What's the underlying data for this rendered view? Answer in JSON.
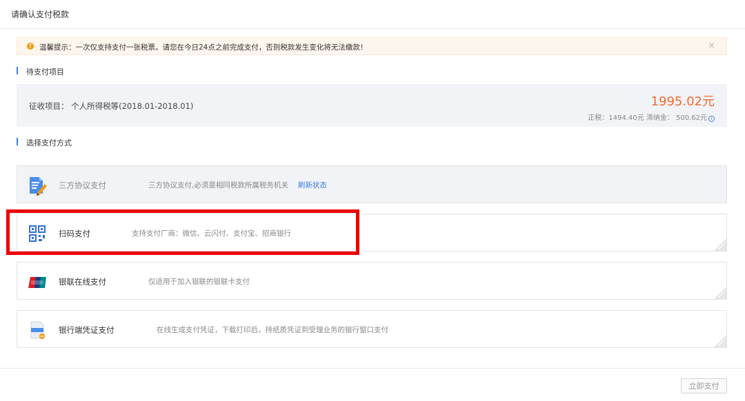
{
  "header": {
    "title": "请确认支付税款"
  },
  "alert": {
    "text": "温馨提示：一次仅支持支付一张税票。请您在今日24点之前完成支付，否则税款发生变化将无法缴款！",
    "close": "×"
  },
  "sections": {
    "pending": "待支付项目",
    "method": "选择支付方式"
  },
  "tax": {
    "label": "征收项目：  个人所得税等(2018.01-2018.01)",
    "amount": "1995.02元",
    "detail": "正税：1494.40元  滞纳金：  500.62元"
  },
  "payment_options": [
    {
      "name": "三方协议支付",
      "desc": "三方协议支付,必须是相同税款所属税务机关",
      "link": "刷新状态",
      "disabled": true
    },
    {
      "name": "扫码支付",
      "desc": "支持支付厂商：微信、云闪付、支付宝、招商银行"
    },
    {
      "name": "银联在线支付",
      "desc": "仅适用于加入银联的银联卡支付"
    },
    {
      "name": "银行端凭证支付",
      "desc": "在线生成支付凭证，下载打印后，持纸质凭证到受理业务的银行窗口支付"
    }
  ],
  "footer": {
    "submit": "立即支付"
  },
  "colors": {
    "accent_blue": "#3a7ee6",
    "amount_orange": "#f26b2e",
    "highlight_red": "#ee0000",
    "alert_bg": "#fdf6ec"
  },
  "icons": {
    "alert": "warning-icon",
    "option_1": "document-pen-icon",
    "option_2": "qr-code-icon",
    "option_3": "unionpay-card-icon",
    "option_4": "bank-voucher-icon"
  }
}
